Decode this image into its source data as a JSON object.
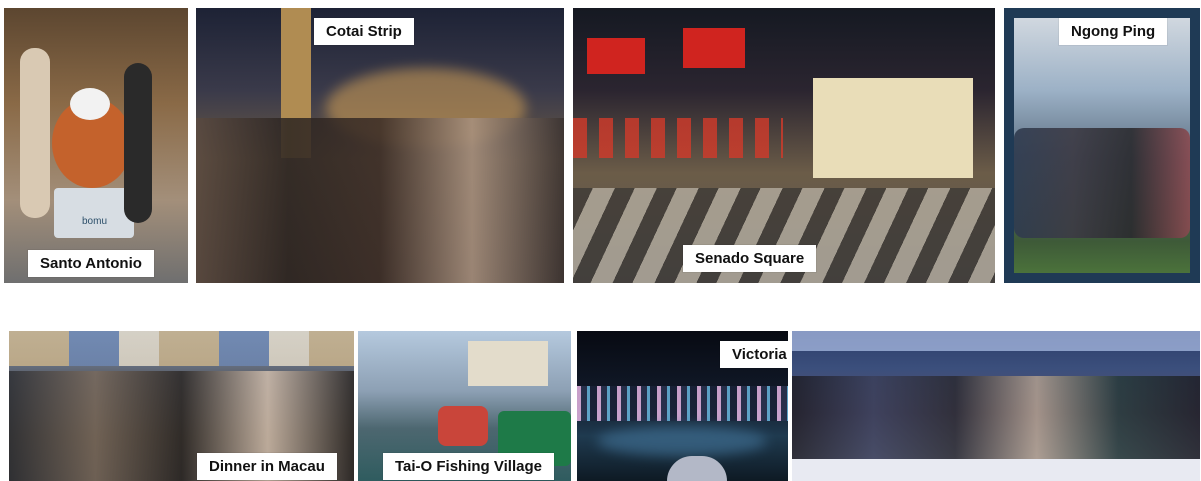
{
  "photos": [
    {
      "id": "santo-antonio",
      "caption": "Santo Antonio"
    },
    {
      "id": "cotai-strip",
      "caption": "Cotai Strip"
    },
    {
      "id": "senado-square",
      "caption": "Senado Square"
    },
    {
      "id": "ngong-ping",
      "caption": "Ngong Ping"
    },
    {
      "id": "dinner-in-macau",
      "caption": "Dinner in Macau"
    },
    {
      "id": "tai-o-fishing-village",
      "caption": "Tai-O Fishing Village"
    },
    {
      "id": "victoria-harbor",
      "caption": "Victoria Harbor"
    },
    {
      "id": "boat-group",
      "caption": ""
    }
  ],
  "signage": {
    "shop_sign": "bomu"
  }
}
